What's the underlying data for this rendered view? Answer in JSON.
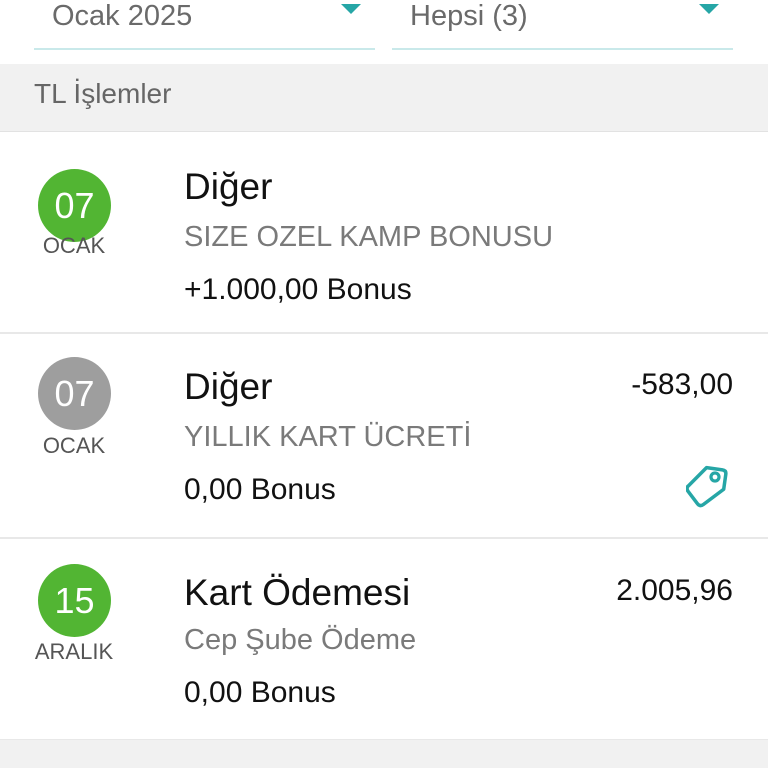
{
  "filters": {
    "month": "Ocak 2025",
    "category": "Hepsi (3)"
  },
  "section": {
    "title": "TL İşlemler"
  },
  "transactions": [
    {
      "day": "07",
      "month": "OCAK",
      "title": "Diğer",
      "description": "SIZE OZEL KAMP BONUSU",
      "bonus": "+1.000,00 Bonus",
      "amount": "",
      "status_color": "#52b533"
    },
    {
      "day": "07",
      "month": "OCAK",
      "title": "Diğer",
      "description": "YILLIK KART ÜCRETİ",
      "bonus": "0,00 Bonus",
      "amount": "-583,00",
      "status_color": "#9e9e9e",
      "action_icon": "tag-icon"
    },
    {
      "day": "15",
      "month": "ARALIK",
      "title": "Kart Ödemesi",
      "description": "Cep Şube Ödeme",
      "bonus": "0,00 Bonus",
      "amount": "2.005,96",
      "status_color": "#52b533"
    }
  ],
  "colors": {
    "accent": "#26a6a6",
    "green": "#52b533",
    "gray": "#9e9e9e"
  }
}
